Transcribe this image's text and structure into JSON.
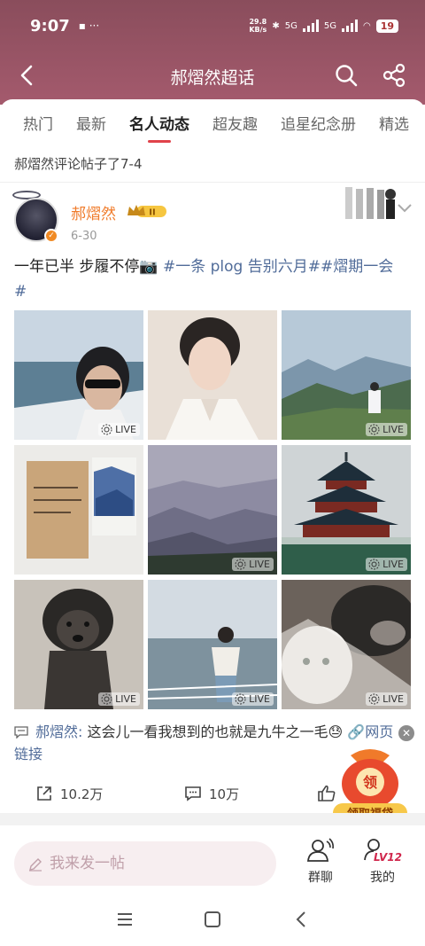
{
  "status": {
    "time": "9:07",
    "speed": "29.8\nKB/s",
    "battery": "19",
    "net1": "5G",
    "net2": "5G"
  },
  "nav": {
    "title": "郝熠然超话"
  },
  "tabs": [
    "热门",
    "最新",
    "名人动态",
    "超友趣",
    "追星纪念册",
    "精选"
  ],
  "notice": "郝熠然评论帖子了7-4",
  "post": {
    "author": "郝熠然",
    "vip_level": "II",
    "date": "6-30",
    "text": "一年已半 步履不停📷 ",
    "topic": "#一条 plog 告别六月##熠期一会#",
    "live_label": "LIVE",
    "images": [
      {
        "name": "selfie-on-boat",
        "live": true
      },
      {
        "name": "portrait-white-suit",
        "live": false
      },
      {
        "name": "mountain-view",
        "live": true
      },
      {
        "name": "note-and-postcard",
        "live": false
      },
      {
        "name": "misty-mountains",
        "live": true
      },
      {
        "name": "temple-of-heaven",
        "live": true
      },
      {
        "name": "dog",
        "live": true
      },
      {
        "name": "man-on-boat",
        "live": true
      },
      {
        "name": "cat-and-dog",
        "live": true
      }
    ],
    "comment_author": "郝熠然:",
    "comment_text": " 这会儿一看我想到的也就是九牛之一毛😓 ",
    "comment_link": "🔗网页链接",
    "reposts": "10.2万",
    "comments": "10万"
  },
  "gift": {
    "label": "领取福袋",
    "glyph": "领"
  },
  "bottom": {
    "placeholder": "我来发一帖",
    "group_chat": "群聊",
    "mine": "我的",
    "level": "LV12"
  },
  "colors": {
    "header": "#8a4d5c",
    "accent": "#e0424a",
    "link": "#516c99",
    "author": "#f07b2a"
  }
}
